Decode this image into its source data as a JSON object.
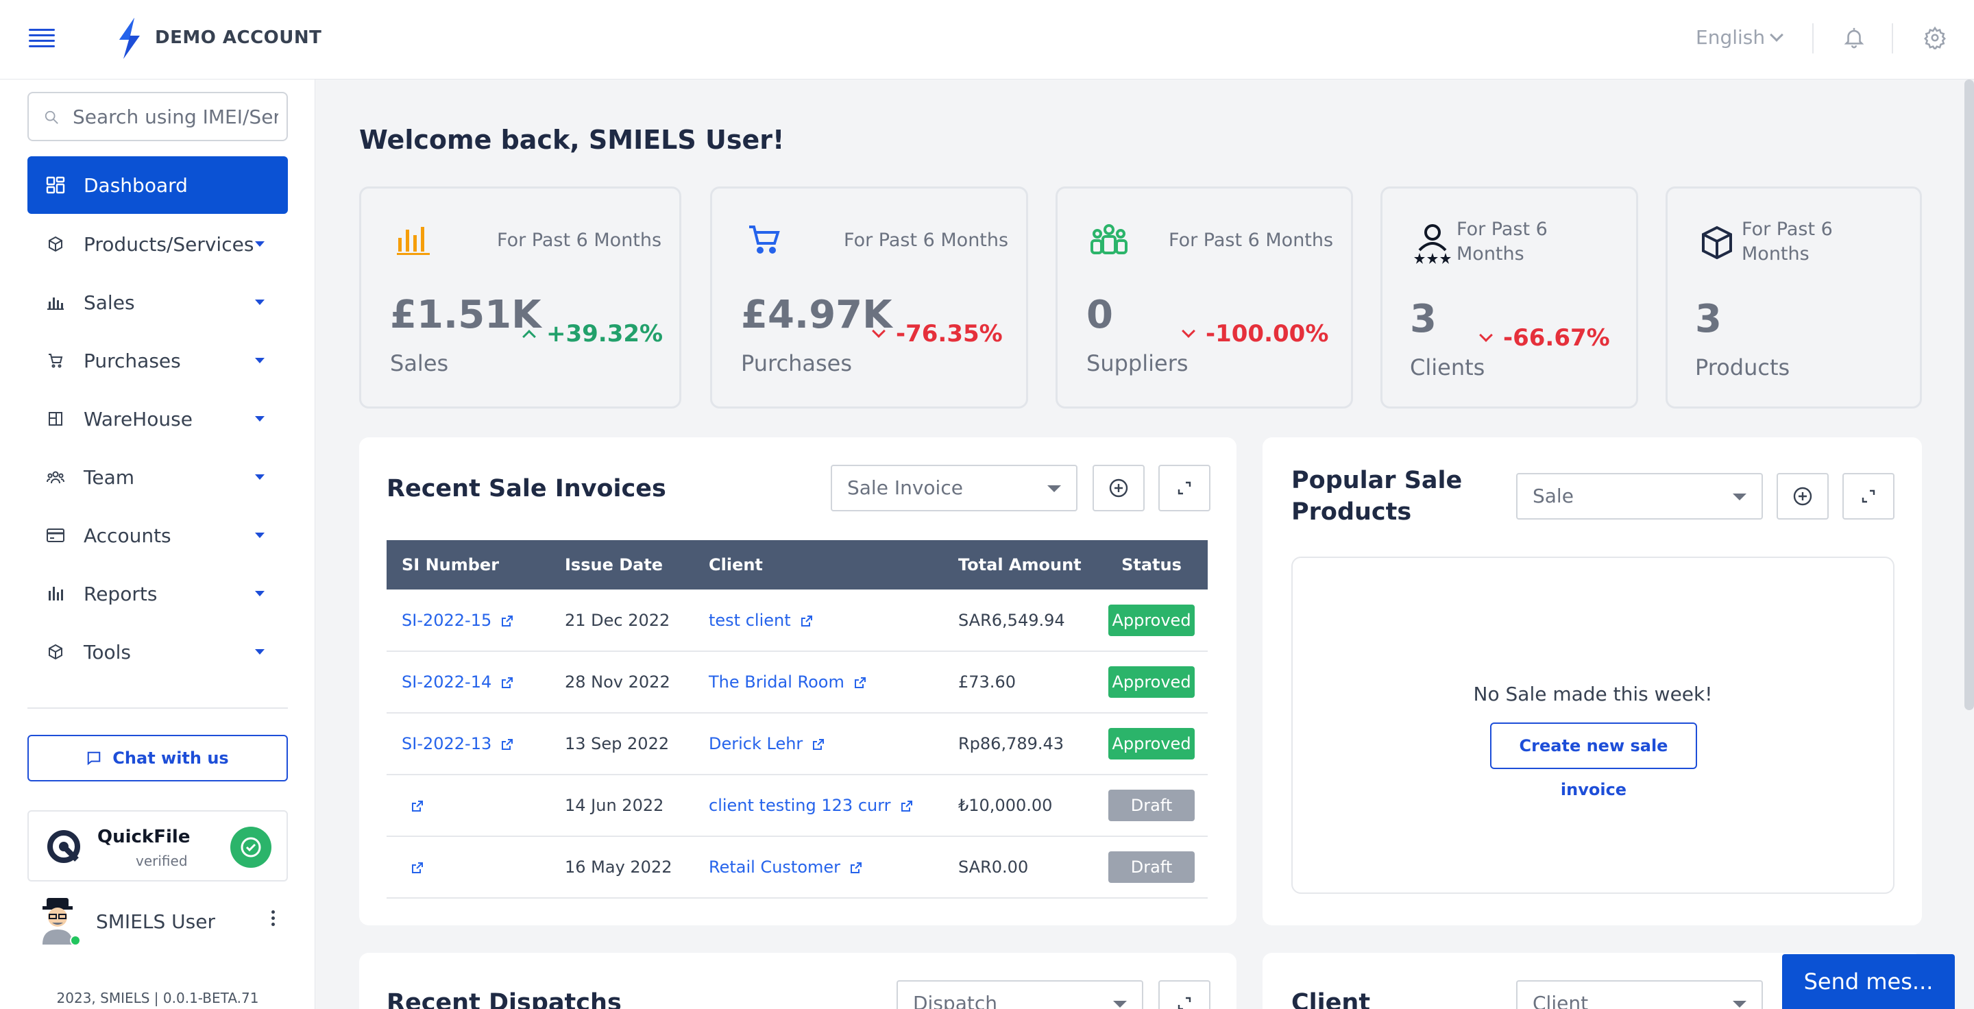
{
  "header": {
    "brand": "DEMO ACCOUNT",
    "language": "English"
  },
  "sidebar": {
    "search_placeholder": "Search using IMEI/Serial",
    "items": [
      {
        "label": "Dashboard",
        "icon": "dashboard-icon",
        "active": true
      },
      {
        "label": "Products/Services",
        "icon": "box-icon"
      },
      {
        "label": "Sales",
        "icon": "bar-chart-icon"
      },
      {
        "label": "Purchases",
        "icon": "cart-icon"
      },
      {
        "label": "WareHouse",
        "icon": "warehouse-icon"
      },
      {
        "label": "Team",
        "icon": "team-icon"
      },
      {
        "label": "Accounts",
        "icon": "card-icon"
      },
      {
        "label": "Reports",
        "icon": "reports-icon"
      },
      {
        "label": "Tools",
        "icon": "box-icon"
      }
    ],
    "chat_label": "Chat with us",
    "quickfile": {
      "name": "QuickFile",
      "status": "verified"
    },
    "user_name": "SMIELS User",
    "version": "2023, SMIELS | 0.0.1-BETA.71"
  },
  "main": {
    "welcome": "Welcome back, SMIELS User!",
    "stats": [
      {
        "period": "For Past 6 Months",
        "value": "£1.51K",
        "label": "Sales",
        "change": "+39.32%",
        "trend": "up",
        "color": "#f59e0b"
      },
      {
        "period": "For Past 6 Months",
        "value": "£4.97K",
        "label": "Purchases",
        "change": "-76.35%",
        "trend": "down",
        "color": "#2563eb"
      },
      {
        "period": "For Past 6 Months",
        "value": "0",
        "label": "Suppliers",
        "change": "-100.00%",
        "trend": "down",
        "color": "#2bb46a"
      },
      {
        "period_line1": "For Past 6",
        "period_line2": "Months",
        "value": "3",
        "label": "Clients",
        "change": "-66.67%",
        "trend": "down"
      },
      {
        "period_line1": "For Past 6",
        "period_line2": "Months",
        "value": "3",
        "label": "Products"
      }
    ],
    "recent_invoices": {
      "title": "Recent Sale Invoices",
      "select_value": "Sale Invoice",
      "columns": [
        "SI Number",
        "Issue Date",
        "Client",
        "Total Amount",
        "Status"
      ],
      "rows": [
        {
          "si": "SI-2022-15",
          "date": "21 Dec 2022",
          "client": "test client",
          "amount": "SAR6,549.94",
          "status": "Approved"
        },
        {
          "si": "SI-2022-14",
          "date": "28 Nov 2022",
          "client": "The Bridal Room",
          "amount": "£73.60",
          "status": "Approved"
        },
        {
          "si": "SI-2022-13",
          "date": "13 Sep 2022",
          "client": "Derick Lehr",
          "amount": "Rp86,789.43",
          "status": "Approved"
        },
        {
          "si": "",
          "date": "14 Jun 2022",
          "client": "client testing 123 curr",
          "amount": "₺10,000.00",
          "status": "Draft"
        },
        {
          "si": "",
          "date": "16 May 2022",
          "client": "Retail Customer",
          "amount": "SAR0.00",
          "status": "Draft"
        }
      ]
    },
    "popular_products": {
      "title_line1": "Popular Sale",
      "title_line2": "Products",
      "select_value": "Sale",
      "empty_message": "No Sale made this week!",
      "create_label": "Create new sale invoice"
    },
    "recent_dispatches": {
      "title": "Recent Dispatchs",
      "select_value": "Dispatch"
    },
    "client_panel": {
      "title": "Client",
      "select_value": "Client"
    },
    "send_message": "Send mes..."
  },
  "colors": {
    "accent": "#0b52d4",
    "approved": "#2bb46a",
    "draft": "#9ca3af",
    "up": "#22a06b",
    "down": "#e5303b"
  }
}
